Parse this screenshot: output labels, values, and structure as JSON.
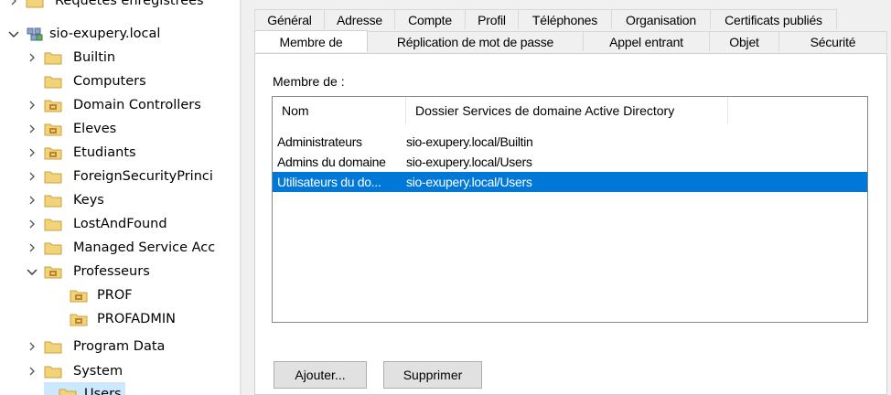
{
  "tree": {
    "items": [
      {
        "label": "Requêtes enregistrées",
        "state": "collapsed",
        "icon": "folder-icon"
      },
      {
        "label": "sio-exupery.local",
        "state": "expanded",
        "icon": "domain-icon"
      },
      {
        "label": "Builtin",
        "state": "collapsed",
        "icon": "folder-icon"
      },
      {
        "label": "Computers",
        "state": "none",
        "icon": "folder-icon"
      },
      {
        "label": "Domain Controllers",
        "state": "collapsed",
        "icon": "ou-icon"
      },
      {
        "label": "Eleves",
        "state": "collapsed",
        "icon": "ou-icon"
      },
      {
        "label": "Etudiants",
        "state": "collapsed",
        "icon": "ou-icon"
      },
      {
        "label": "ForeignSecurityPrinci",
        "state": "collapsed",
        "icon": "folder-icon"
      },
      {
        "label": "Keys",
        "state": "collapsed",
        "icon": "folder-icon"
      },
      {
        "label": "LostAndFound",
        "state": "collapsed",
        "icon": "folder-icon"
      },
      {
        "label": "Managed Service Acc",
        "state": "collapsed",
        "icon": "folder-icon"
      },
      {
        "label": "Professeurs",
        "state": "expanded",
        "icon": "ou-icon"
      },
      {
        "label": "PROF",
        "state": "none",
        "icon": "ou-icon"
      },
      {
        "label": "PROFADMIN",
        "state": "none",
        "icon": "ou-icon"
      },
      {
        "label": "Program Data",
        "state": "collapsed",
        "icon": "folder-icon"
      },
      {
        "label": "System",
        "state": "collapsed",
        "icon": "folder-icon"
      },
      {
        "label": "Users",
        "state": "none",
        "icon": "folder-icon"
      }
    ]
  },
  "dialog": {
    "tabs_row1": [
      "Général",
      "Adresse",
      "Compte",
      "Profil",
      "Téléphones",
      "Organisation",
      "Certificats publiés"
    ],
    "tabs_row2": [
      "Membre de",
      "Réplication de mot de passe",
      "Appel entrant",
      "Objet",
      "Sécurité"
    ],
    "active_tab": "Membre de",
    "member_of_label": "Membre de :",
    "columns": [
      "Nom",
      "Dossier Services de domaine Active Directory"
    ],
    "rows": [
      {
        "name": "Administrateurs",
        "folder": "sio-exupery.local/Builtin",
        "selected": false
      },
      {
        "name": "Admins du domaine",
        "folder": "sio-exupery.local/Users",
        "selected": false
      },
      {
        "name": "Utilisateurs du do...",
        "folder": "sio-exupery.local/Users",
        "selected": true
      }
    ],
    "add_button": "Ajouter...",
    "remove_button": "Supprimer",
    "colors": {
      "selection": "#0078d7",
      "panel": "#f0f0f0"
    }
  }
}
